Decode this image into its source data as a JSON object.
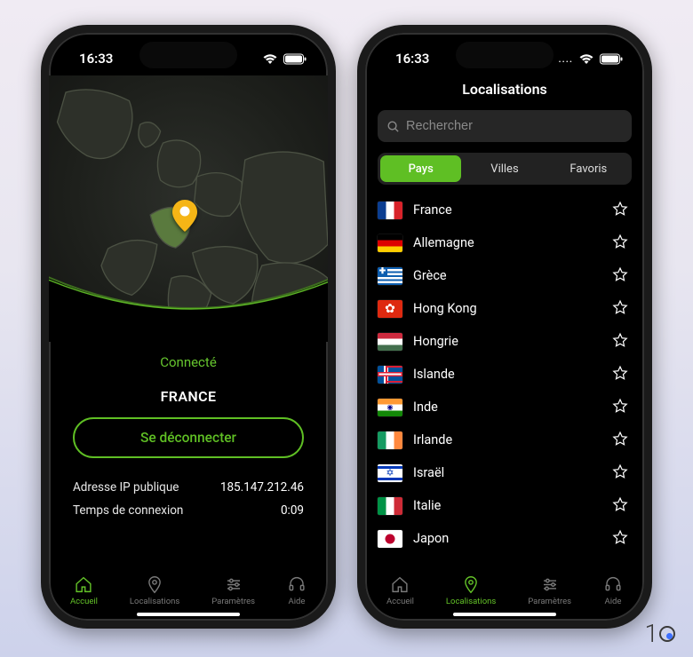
{
  "statusbar": {
    "time": "16:33"
  },
  "accent": "#5fbf24",
  "screen1": {
    "status": "Connecté",
    "country": "FRANCE",
    "disconnect": "Se déconnecter",
    "ip_label": "Adresse IP publique",
    "ip_value": "185.147.212.46",
    "time_label": "Temps de connexion",
    "time_value": "0:09"
  },
  "screen2": {
    "title": "Localisations",
    "search_placeholder": "Rechercher",
    "segments": {
      "countries": "Pays",
      "cities": "Villes",
      "favorites": "Favoris"
    },
    "countries": [
      {
        "name": "France",
        "flag": "fr"
      },
      {
        "name": "Allemagne",
        "flag": "de"
      },
      {
        "name": "Grèce",
        "flag": "gr"
      },
      {
        "name": "Hong Kong",
        "flag": "hk"
      },
      {
        "name": "Hongrie",
        "flag": "hu"
      },
      {
        "name": "Islande",
        "flag": "is"
      },
      {
        "name": "Inde",
        "flag": "in"
      },
      {
        "name": "Irlande",
        "flag": "ie"
      },
      {
        "name": "Israël",
        "flag": "il"
      },
      {
        "name": "Italie",
        "flag": "it"
      },
      {
        "name": "Japon",
        "flag": "jp"
      }
    ]
  },
  "tabs": {
    "home": "Accueil",
    "locations": "Localisations",
    "settings": "Paramètres",
    "help": "Aide"
  },
  "brand": "1"
}
